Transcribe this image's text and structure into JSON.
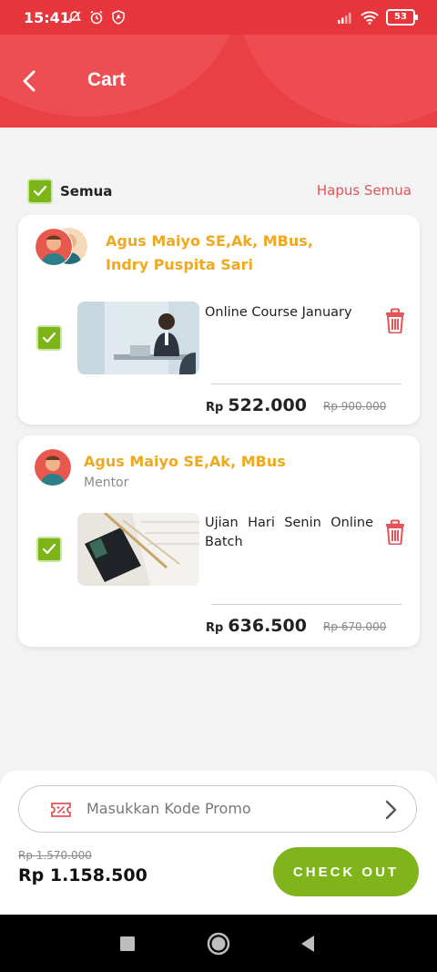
{
  "status_bar": {
    "time": "15:41",
    "battery": "53"
  },
  "header": {
    "title": "Cart"
  },
  "select_all": {
    "label": "Semua",
    "checked": true
  },
  "clear_all_label": "Hapus Semua",
  "items": [
    {
      "mentor_line1": "Agus Maiyo SE,Ak, MBus,",
      "mentor_line2": "Indry Puspita Sari",
      "title": "Online Course January",
      "price_prefix": "Rp",
      "price": "522.000",
      "old_price": "Rp 900.000",
      "checked": true
    },
    {
      "mentor_line1": "Agus Maiyo SE,Ak, MBus",
      "role": "Mentor",
      "title_line1": "Ujian Hari Senin Online",
      "title_line2": "Batch",
      "price_prefix": "Rp",
      "price": "636.500",
      "old_price": "Rp 670.000",
      "checked": true
    }
  ],
  "promo": {
    "placeholder": "Masukkan Kode Promo"
  },
  "summary": {
    "old_total": "Rp 1.570.000",
    "total": "Rp 1.158.500",
    "checkout_label": "CHECK OUT"
  },
  "colors": {
    "header": "#ea4045",
    "accent_orange": "#f0a81e",
    "check_green": "#7cb518",
    "checkout_green": "#7fb51a",
    "danger": "#e25457"
  }
}
